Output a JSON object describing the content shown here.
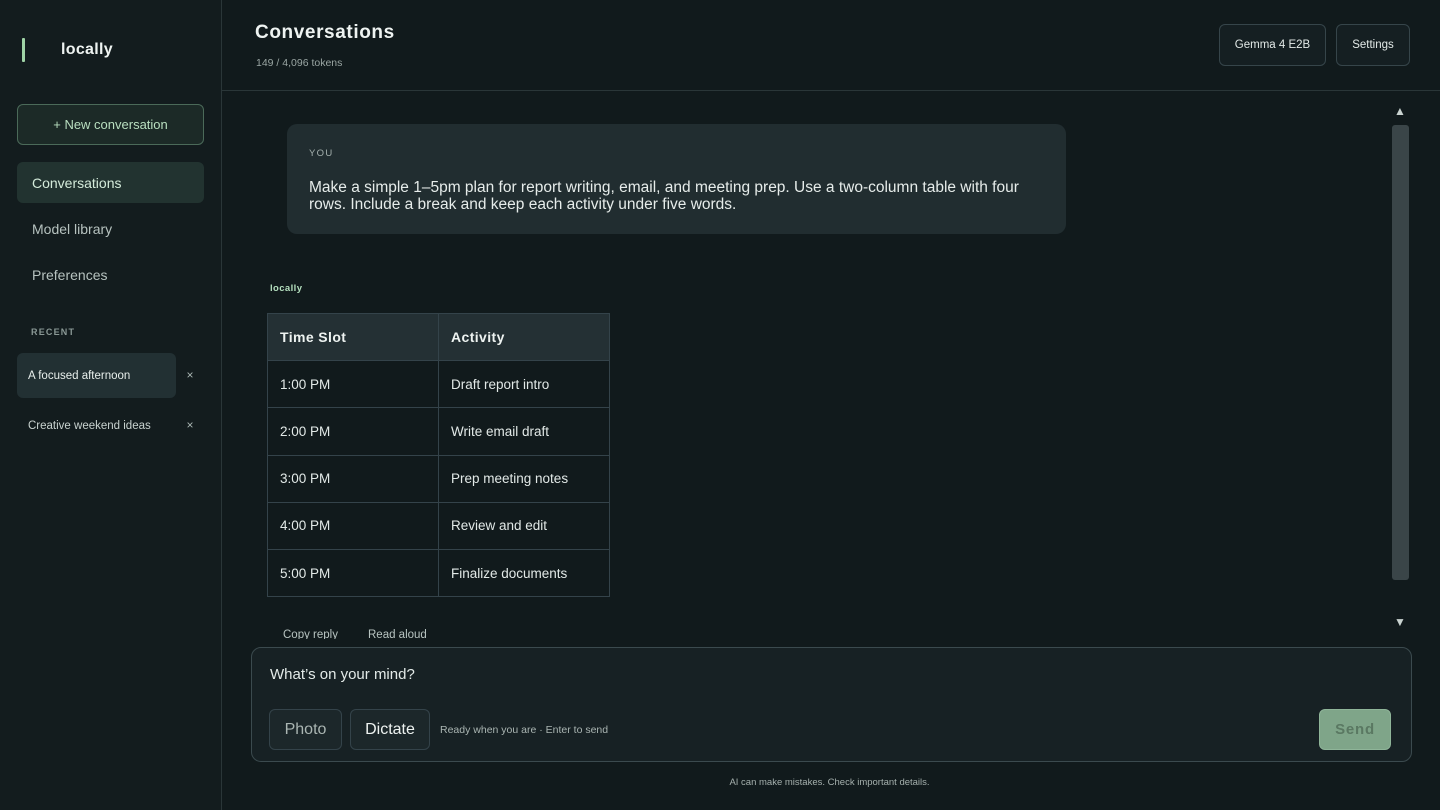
{
  "sidebar": {
    "brand": "locally",
    "new_button": "+ New conversation",
    "nav": [
      {
        "label": "Conversations",
        "active": true
      },
      {
        "label": "Model library",
        "active": false
      },
      {
        "label": "Preferences",
        "active": false
      }
    ],
    "recent_label": "RECENT",
    "recent": [
      {
        "label": "A focused afternoon",
        "active": true
      },
      {
        "label": "Creative weekend ideas",
        "active": false
      }
    ],
    "close_glyph": "×"
  },
  "header": {
    "title": "Conversations",
    "tokens": "149 / 4,096 tokens",
    "model_button": "Gemma 4 E2B",
    "settings_button": "Settings"
  },
  "messages": {
    "user_label": "YOU",
    "user_text": "Make a simple 1–5pm plan for report writing, email, and meeting prep. Use a two-column table with four rows. Include a break and keep each activity under five words.",
    "assistant_label": "locally",
    "table": {
      "headers": [
        "Time Slot",
        "Activity"
      ],
      "rows": [
        [
          "1:00 PM",
          "Draft report intro"
        ],
        [
          "2:00 PM",
          "Write email draft"
        ],
        [
          "3:00 PM",
          "Prep meeting notes"
        ],
        [
          "4:00 PM",
          "Review and edit"
        ],
        [
          "5:00 PM",
          "Finalize documents"
        ]
      ]
    },
    "actions": {
      "copy": "Copy reply",
      "read": "Read aloud"
    }
  },
  "scroll": {
    "up": "▲",
    "down": "▼"
  },
  "composer": {
    "placeholder": "What’s on your mind?",
    "photo": "Photo",
    "dictate": "Dictate",
    "hint": "Ready when you are · Enter to send",
    "send": "Send"
  },
  "footer": {
    "disclaimer": "AI can make mistakes. Check important details."
  },
  "colors": {
    "accent": "#9fd3a6",
    "send_bg": "#7fa589",
    "background": "#111a1c"
  }
}
